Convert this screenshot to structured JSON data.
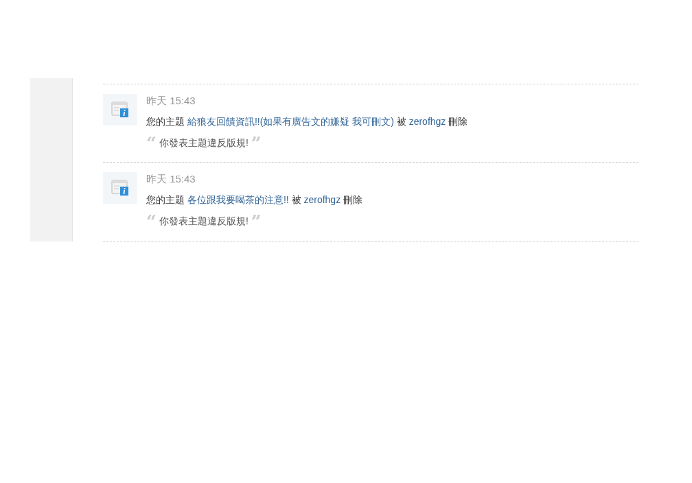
{
  "notifications": [
    {
      "time": "昨天 15:43",
      "prefix": "您的主題",
      "topic": "給狼友回饋資訊!!(如果有廣告文的嫌疑 我可刪文)",
      "by": "被",
      "user": "zerofhgz",
      "action": "刪除",
      "open_quote": "“",
      "reason": "你發表主題違反版規!",
      "close_quote": "”"
    },
    {
      "time": "昨天 15:43",
      "prefix": "您的主題",
      "topic": "各位跟我要喝茶的注意!!",
      "by": "被",
      "user": "zerofhgz",
      "action": "刪除",
      "open_quote": "“",
      "reason": "你發表主題違反版規!",
      "close_quote": "”"
    }
  ]
}
